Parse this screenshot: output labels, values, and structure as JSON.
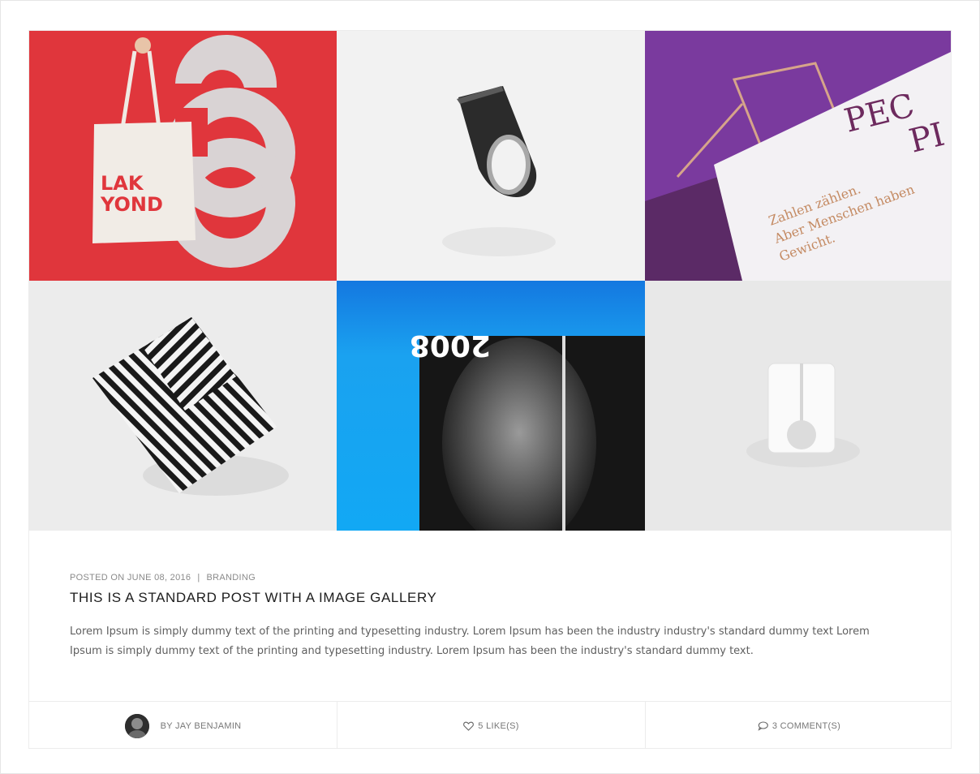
{
  "post": {
    "meta": {
      "posted_on": "POSTED ON JUNE 08, 2016",
      "separator": "|",
      "category": "BRANDING"
    },
    "title": "THIS IS A STANDARD POST WITH A IMAGE GALLERY",
    "excerpt": "Lorem Ipsum is simply dummy text of the printing and typesetting industry. Lorem Ipsum has been the industry industry's standard dummy text Lorem Ipsum is simply dummy text of the printing and typesetting industry. Lorem Ipsum has been the industry's standard dummy text."
  },
  "gallery": {
    "tiles": [
      {
        "name": "gallery-image-tote-bag",
        "bag_text_line1": "LAK",
        "bag_text_line2": "YOND"
      },
      {
        "name": "gallery-image-ring"
      },
      {
        "name": "gallery-image-print-magazine",
        "headline_letters": "PEC",
        "headline_letters_2": "PI",
        "german_line1": "Zahlen zählen.",
        "german_line2": "Aber Menschen haben",
        "german_line3": "Gewicht."
      },
      {
        "name": "gallery-image-pattern-paper"
      },
      {
        "name": "gallery-image-magazine-face",
        "cover_number": "2008"
      },
      {
        "name": "gallery-image-white-object"
      }
    ]
  },
  "footer": {
    "author": "BY JAY BENJAMIN",
    "likes": "5 LIKE(S)",
    "comments": "3 COMMENT(S)",
    "icons": {
      "likes": "heart-icon",
      "comments": "comment-bubble-icon"
    }
  },
  "colors": {
    "red_tile": "#e0363c",
    "purple_tile": "#7a3a9e",
    "blue_tile": "#1aa2f0",
    "text_dark": "#1e1e1e",
    "text_muted": "#8a8a8a"
  }
}
